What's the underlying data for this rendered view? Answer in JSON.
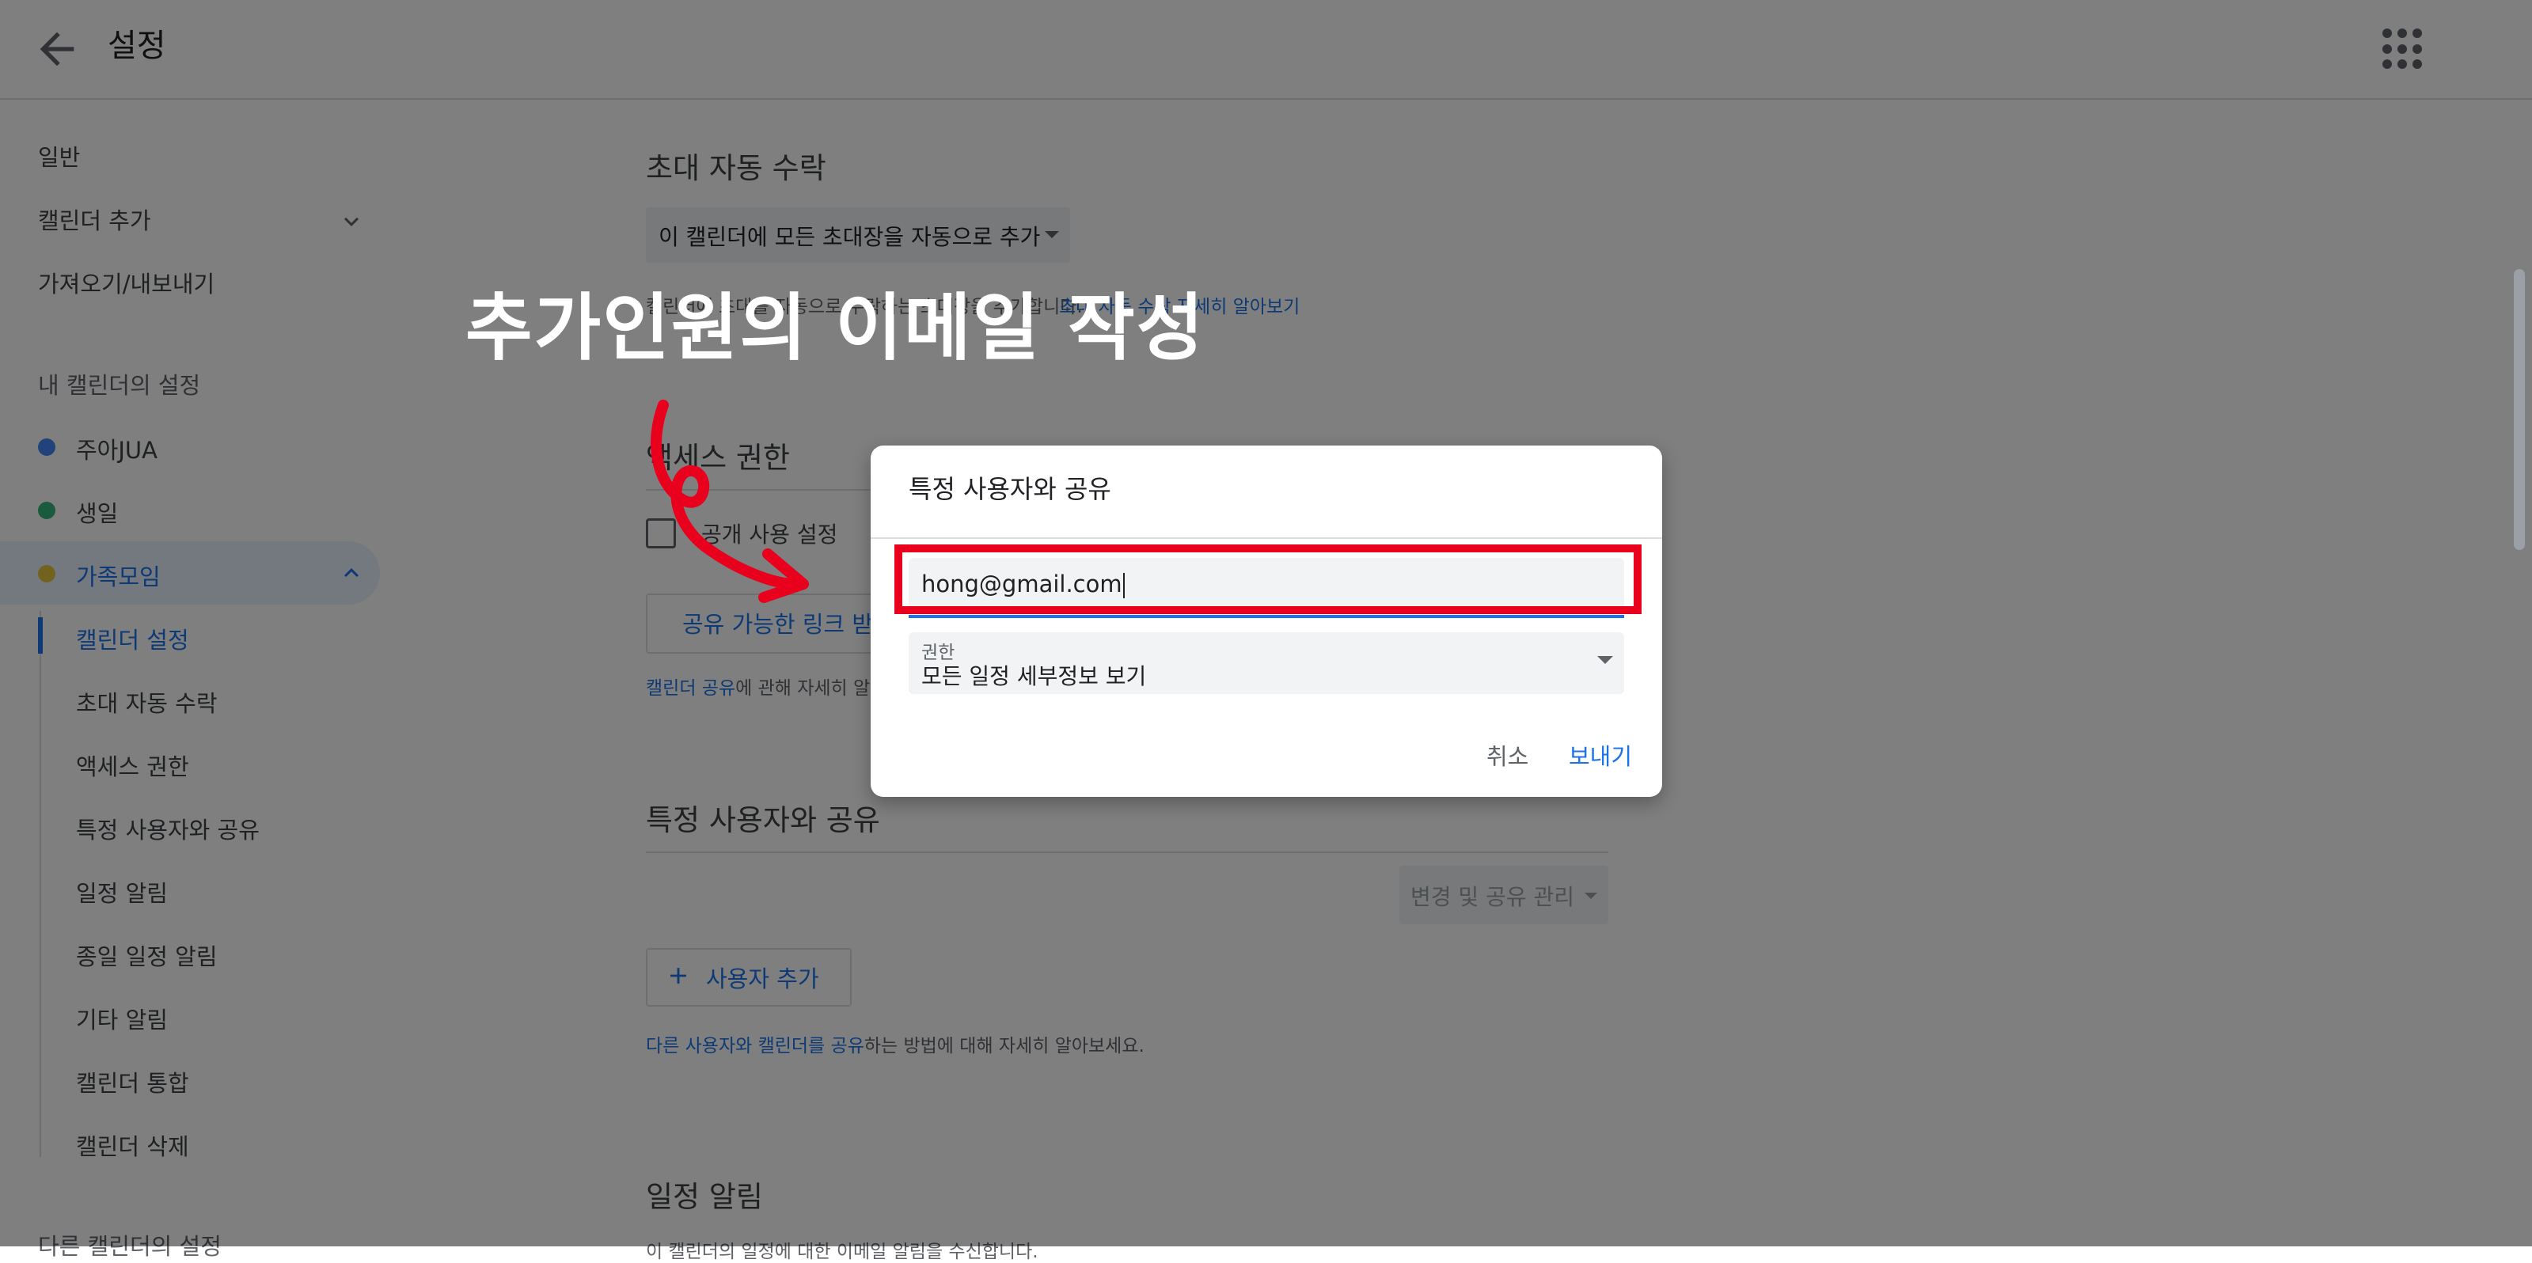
{
  "header": {
    "title": "설정"
  },
  "sidebar": {
    "general": "일반",
    "add_calendar": "캘린더 추가",
    "import_export": "가져오기/내보내기",
    "my_calendars_heading": "내 캘린더의 설정",
    "calendars": [
      {
        "name": "주아JUA",
        "color": "#4285f4"
      },
      {
        "name": "생일",
        "color": "#33b679"
      },
      {
        "name": "가족모임",
        "color": "#e4c441"
      }
    ],
    "subitems": [
      "캘린더 설정",
      "초대 자동 수락",
      "액세스 권한",
      "특정 사용자와 공유",
      "일정 알림",
      "종일 일정 알림",
      "기타 알림",
      "캘린더 통합",
      "캘린더 삭제"
    ],
    "other_calendars_heading": "다른 캘린더의 설정"
  },
  "main": {
    "auto_accept": {
      "title": "초대 자동 수락",
      "select_value": "이 캘린더에 모든 초대장을 자동으로 추가",
      "help_prefix": "캘린더에 초대를 자동으로 수락하는 초대장을 추가합니다.",
      "help_link": "초대 자동 수락 자세히 알아보기"
    },
    "access": {
      "title": "액세스 권한",
      "public_label": "공개 사용 설정",
      "link_button": "공유 가능한 링크 받기",
      "help_link": "캘린더 공유",
      "help_suffix": "에 관해 자세히 알아보세요."
    },
    "share": {
      "title": "특정 사용자와 공유",
      "manage_select": "변경 및 공유 관리",
      "add_button": "사용자 추가",
      "help_link": "다른 사용자와 캘린더를 공유",
      "help_suffix": "하는 방법에 대해 자세히 알아보세요."
    },
    "event_alerts": {
      "title": "일정 알림",
      "desc": "이 캘린더의 일정에 대한 이메일 알림을 수신합니다."
    }
  },
  "dialog": {
    "title": "특정 사용자와 공유",
    "email_value": "hong@gmail.com",
    "permission_label": "권한",
    "permission_value": "모든 일정 세부정보 보기",
    "cancel": "취소",
    "send": "보내기"
  },
  "annotation": {
    "text": "추가인원의 이메일 작성",
    "color": "#e8001c"
  }
}
